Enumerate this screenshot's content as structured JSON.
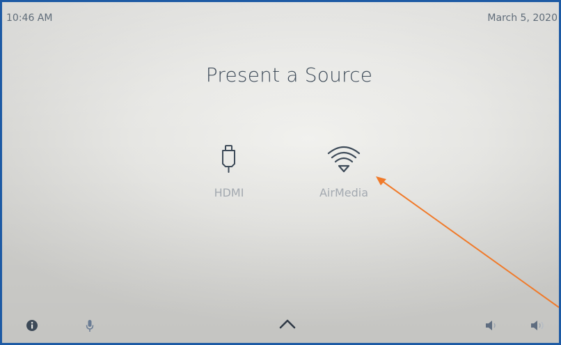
{
  "status_bar": {
    "time": "10:46 AM",
    "date": "March 5, 2020"
  },
  "main": {
    "title": "Present a Source",
    "sources": [
      {
        "label": "HDMI",
        "icon": "hdmi-plug-icon"
      },
      {
        "label": "AirMedia",
        "icon": "wifi-icon"
      }
    ]
  },
  "bottom_bar": {
    "icons": [
      "info-icon",
      "microphone-icon",
      "chevron-up-icon",
      "volume-down-icon",
      "volume-up-icon"
    ]
  },
  "colors": {
    "frame": "#1d5aa4",
    "text": "#5e6b78",
    "title": "#3d4a58",
    "label": "#a3a9b0",
    "icon": "#3d4a58",
    "annotation": "#f07a2a"
  }
}
